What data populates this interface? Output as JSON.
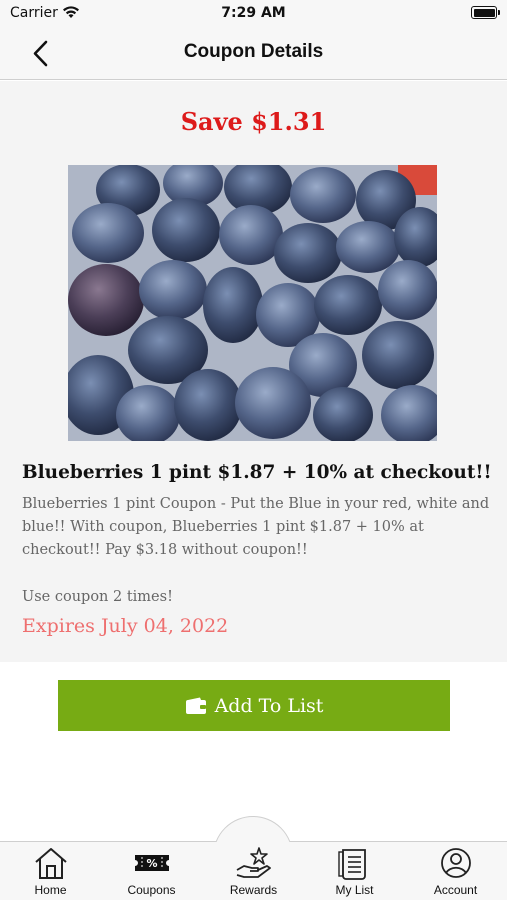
{
  "status_bar": {
    "carrier": "Carrier",
    "time": "7:29 AM"
  },
  "header": {
    "title": "Coupon Details"
  },
  "coupon": {
    "save_text": "Save $1.31",
    "title": "Blueberries 1 pint $1.87 + 10% at checkout!!",
    "description": "Blueberries 1 pint Coupon - Put the Blue in your red, white and blue!!  With coupon, Blueberries 1 pint $1.87 + 10% at checkout!! Pay $3.18 without coupon!!",
    "usage": "Use coupon 2 times!",
    "expires": "Expires July 04, 2022",
    "add_button_label": "Add To List"
  },
  "tabs": [
    {
      "label": "Home",
      "icon": "home-icon"
    },
    {
      "label": "Coupons",
      "icon": "coupon-ticket-icon"
    },
    {
      "label": "Rewards",
      "icon": "rewards-star-hand-icon"
    },
    {
      "label": "My List",
      "icon": "list-icon"
    },
    {
      "label": "Account",
      "icon": "account-icon"
    }
  ],
  "colors": {
    "save": "#dd1a1a",
    "expires": "#ee6f6f",
    "button": "#77ab14"
  }
}
